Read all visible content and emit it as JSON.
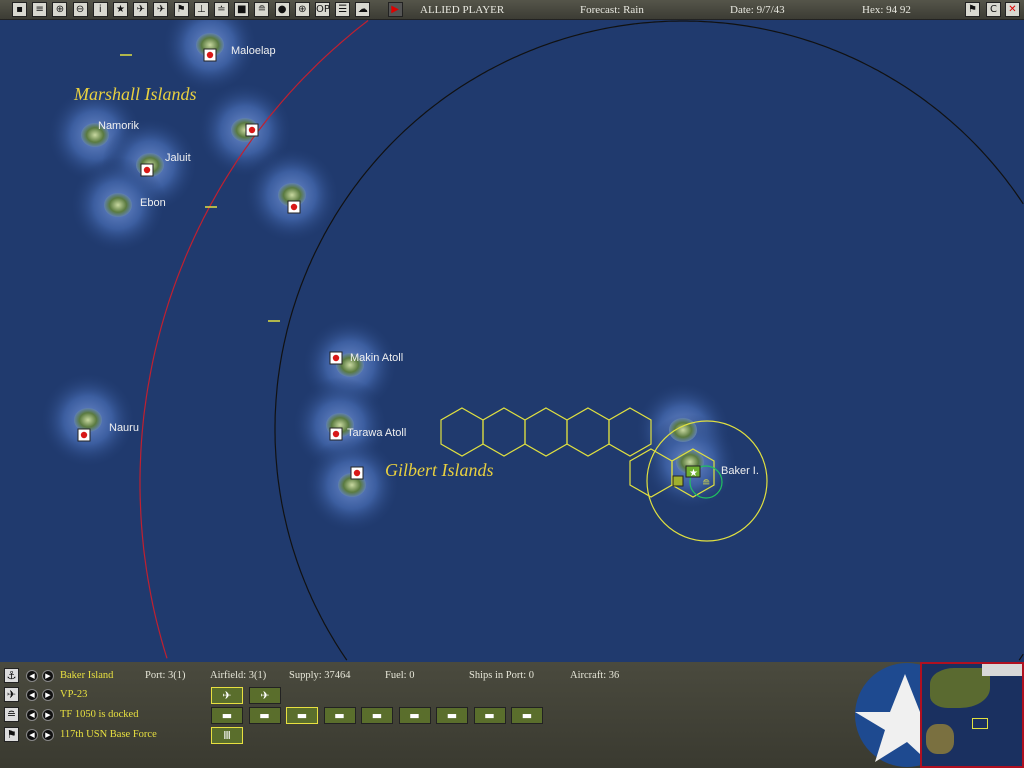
{
  "toolbar": {
    "icons": [
      "save-icon",
      "report-icon",
      "ship-report-icon",
      "air-report-icon",
      "info-icon",
      "star-icon",
      "allied-plane-icon",
      "japan-plane-icon",
      "flag-icon",
      "base-icon",
      "ship-move-icon",
      "side-icon",
      "task-force-icon",
      "globe-icon",
      "target-icon",
      "op-icon",
      "list-icon",
      "weather-icon",
      "end-turn-icon"
    ],
    "op_label": "OP",
    "info_label": "i",
    "player": "ALLIED PLAYER",
    "forecast": "Forecast: Rain",
    "date": "Date: 9/7/43",
    "hex": "Hex: 94  92",
    "c_label": "C"
  },
  "map": {
    "region_labels": [
      "Marshall Islands",
      "Gilbert Islands"
    ],
    "island_labels": [
      "Maloelap",
      "Namorik",
      "Jaluit",
      "Ebon",
      "Makin Atoll",
      "Tarawa Atoll",
      "Nauru",
      "Baker I."
    ]
  },
  "panel": {
    "base": {
      "name": "Baker Island",
      "port": "Port: 3(1)",
      "airfield": "Airfield: 3(1)",
      "supply": "Supply: 37464",
      "fuel": "Fuel: 0",
      "ships": "Ships in Port: 0",
      "aircraft": "Aircraft: 36"
    },
    "air_unit": "VP-23",
    "task_force": "TF 1050 is docked",
    "land_unit": "117th USN Base Force"
  },
  "colors": {
    "ocean": "#203a6e",
    "japan_flag": "#d81818",
    "label_yellow": "#e8d040",
    "range_red": "#c02030"
  }
}
